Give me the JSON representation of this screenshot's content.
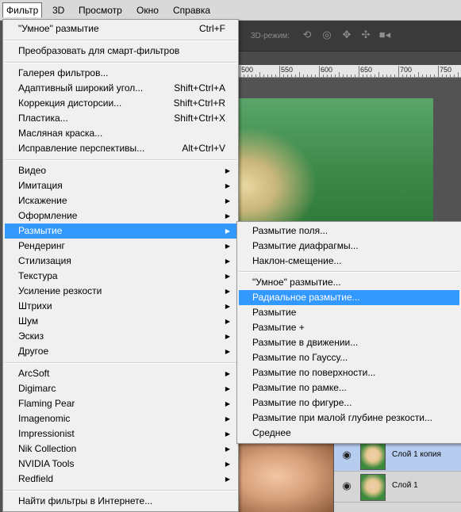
{
  "menubar": {
    "items": [
      "Фильтр",
      "3D",
      "Просмотр",
      "Окно",
      "Справка"
    ]
  },
  "options_bar": {
    "mode_label": "3D-режим:",
    "icons": [
      "rotate-3d-icon",
      "roll-3d-icon",
      "drag-3d-icon",
      "slide-3d-icon",
      "video-camera-icon"
    ]
  },
  "ruler": {
    "labels": [
      "500",
      "550",
      "600",
      "650",
      "700",
      "750"
    ]
  },
  "filter_menu": {
    "group1": [
      {
        "label": "\"Умное\" размытие",
        "shortcut": "Ctrl+F"
      }
    ],
    "group2": [
      {
        "label": "Преобразовать для смарт-фильтров"
      }
    ],
    "group3": [
      {
        "label": "Галерея фильтров..."
      },
      {
        "label": "Адаптивный широкий угол...",
        "shortcut": "Shift+Ctrl+A"
      },
      {
        "label": "Коррекция дисторсии...",
        "shortcut": "Shift+Ctrl+R"
      },
      {
        "label": "Пластика...",
        "shortcut": "Shift+Ctrl+X"
      },
      {
        "label": "Масляная краска..."
      },
      {
        "label": "Исправление перспективы...",
        "shortcut": "Alt+Ctrl+V"
      }
    ],
    "group4": [
      {
        "label": "Видео"
      },
      {
        "label": "Имитация"
      },
      {
        "label": "Искажение"
      },
      {
        "label": "Оформление"
      },
      {
        "label": "Размытие"
      },
      {
        "label": "Рендеринг"
      },
      {
        "label": "Стилизация"
      },
      {
        "label": "Текстура"
      },
      {
        "label": "Усиление резкости"
      },
      {
        "label": "Штрихи"
      },
      {
        "label": "Шум"
      },
      {
        "label": "Эскиз"
      },
      {
        "label": "Другое"
      }
    ],
    "group5": [
      {
        "label": "ArcSoft"
      },
      {
        "label": "Digimarc"
      },
      {
        "label": "Flaming Pear"
      },
      {
        "label": "Imagenomic"
      },
      {
        "label": "Impressionist"
      },
      {
        "label": "Nik Collection"
      },
      {
        "label": "NVIDIA Tools"
      },
      {
        "label": "Redfield"
      }
    ],
    "group6": [
      {
        "label": "Найти фильтры в Интернете..."
      }
    ],
    "highlighted": "Размытие"
  },
  "blur_submenu": {
    "group1": [
      {
        "label": "Размытие поля..."
      },
      {
        "label": "Размытие диафрагмы..."
      },
      {
        "label": "Наклон-смещение..."
      }
    ],
    "group2": [
      {
        "label": "\"Умное\" размытие..."
      },
      {
        "label": "Радиальное размытие..."
      },
      {
        "label": "Размытие"
      },
      {
        "label": "Размытие +"
      },
      {
        "label": "Размытие в движении..."
      },
      {
        "label": "Размытие по Гауссу..."
      },
      {
        "label": "Размытие по поверхности..."
      },
      {
        "label": "Размытие по рамке..."
      },
      {
        "label": "Размытие по фигуре..."
      },
      {
        "label": "Размытие при малой глубине резкости..."
      },
      {
        "label": "Среднее"
      }
    ],
    "highlighted": "Радиальное размытие..."
  },
  "layers": [
    {
      "name": "Слой 1 копия",
      "selected": true
    },
    {
      "name": "Слой 1",
      "selected": false
    }
  ],
  "colors": {
    "highlight": "#3399ff",
    "menu_bg": "#f0f0f0",
    "layer_selected": "#b6cdf0"
  }
}
